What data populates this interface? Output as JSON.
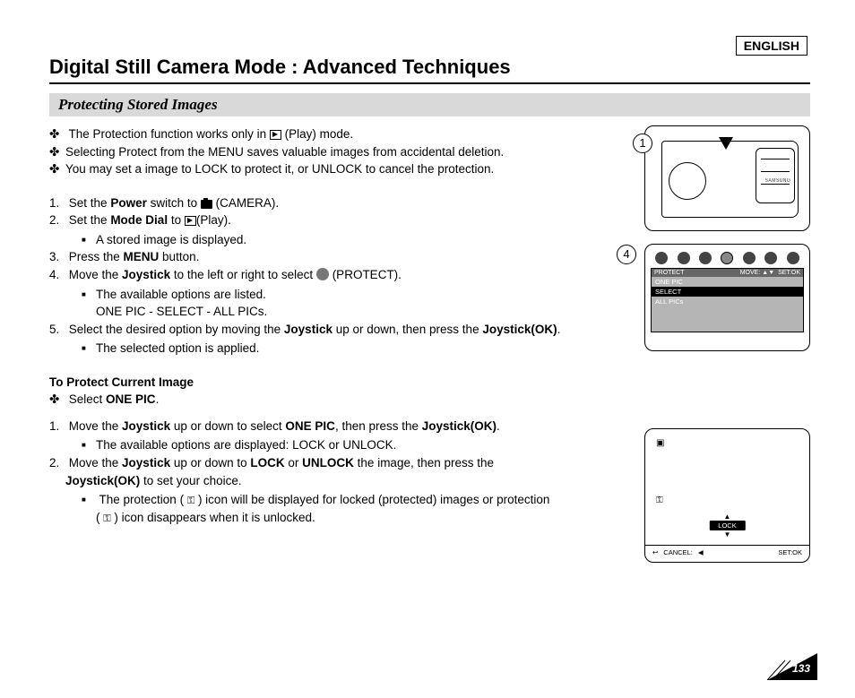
{
  "lang": "ENGLISH",
  "title": "Digital Still Camera Mode : Advanced Techniques",
  "subhead": "Protecting Stored Images",
  "intro": [
    "The Protection function works only in      (Play) mode.",
    "Selecting Protect from the MENU saves valuable images from accidental deletion.",
    "You may set a image to LOCK to protect it, or UNLOCK to cancel the protection."
  ],
  "steps": {
    "s1a": "Set the ",
    "s1b": "Power",
    "s1c": " switch to ",
    "s1d": " (CAMERA).",
    "s2a": "Set the ",
    "s2b": "Mode Dial",
    "s2c": " to ",
    "s2d": "(Play).",
    "s2sub": "A stored image is displayed.",
    "s3a": "Press the ",
    "s3b": "MENU",
    "s3c": " button.",
    "s4a": "Move the ",
    "s4b": "Joystick",
    "s4c": " to the left or right to select ",
    "s4d": " (PROTECT).",
    "s4sub1": "The available options are listed.",
    "s4sub2": "ONE PIC - SELECT - ALL PICs.",
    "s5a": "Select the desired option by moving the ",
    "s5b": "Joystick",
    "s5c": " up or down, then press the ",
    "s5d": "Joystick(OK)",
    "s5e": ".",
    "s5sub": "The selected option is applied."
  },
  "sec2": {
    "heading": "To Protect Current Image",
    "b1a": "Select ",
    "b1b": "ONE PIC",
    "b1c": ".",
    "n1a": "Move the ",
    "n1b": "Joystick",
    "n1c": " up or down to select ",
    "n1d": "ONE PIC",
    "n1e": ", then press the ",
    "n1f": "Joystick(OK)",
    "n1g": ".",
    "n1sub": "The available options are displayed: LOCK or UNLOCK.",
    "n2a": "Move the ",
    "n2b": "Joystick",
    "n2c": " up or down to ",
    "n2d": "LOCK",
    "n2e": " or ",
    "n2f": "UNLOCK",
    "n2g": " the image, then press the ",
    "n2h": "Joystick(OK)",
    "n2i": " to set your choice.",
    "n2sub1": "The protection (        ) icon will be displayed for locked (protected) images or protection",
    "n2sub2": "(        ) icon disappears when it is unlocked."
  },
  "fig": {
    "step1": "1",
    "step4": "4",
    "samsung": "SAMSUNG",
    "menu": {
      "title": "PROTECT",
      "move": "MOVE:",
      "set": "SET:OK",
      "items": [
        "ONE PIC",
        "SELECT",
        "ALL PICs"
      ]
    },
    "lock": {
      "label": "LOCK",
      "cancel": "CANCEL:",
      "set": "SET:OK"
    }
  },
  "pagenum": "133"
}
